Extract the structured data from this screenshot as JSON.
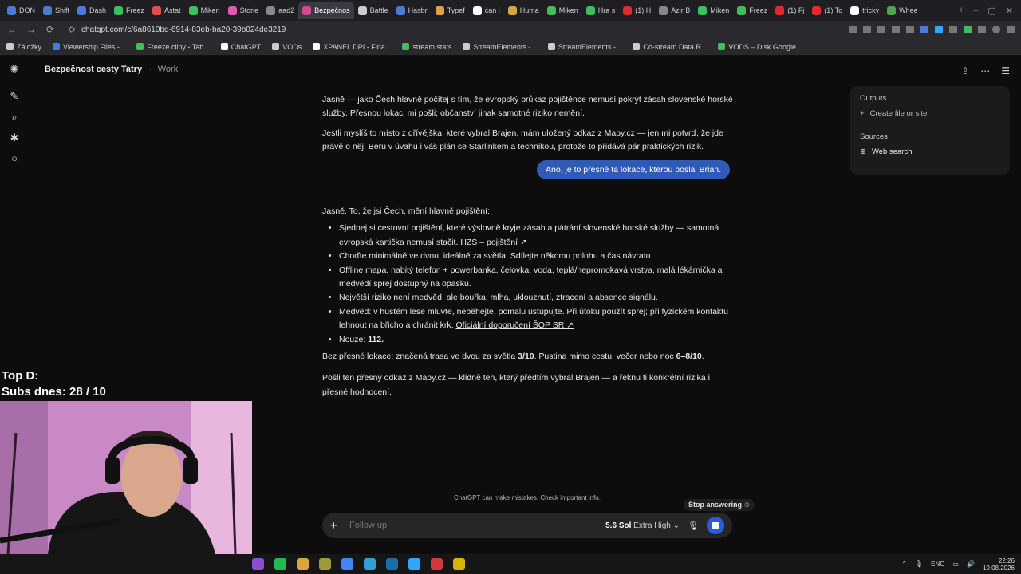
{
  "browser": {
    "tabs": [
      {
        "label": "DON",
        "color": "#4a7bd6"
      },
      {
        "label": "Shift",
        "color": "#4a7bd6"
      },
      {
        "label": "Dash",
        "color": "#4a7bd6"
      },
      {
        "label": "Freez",
        "color": "#3fbf5a"
      },
      {
        "label": "Astat",
        "color": "#e14c4c"
      },
      {
        "label": "Miken",
        "color": "#3fbf5a"
      },
      {
        "label": "Storie",
        "color": "#e05bb0"
      },
      {
        "label": "aad2",
        "color": "#888888"
      },
      {
        "label": "Bezpečnos",
        "color": "#d14a8f",
        "active": true
      },
      {
        "label": "Battle",
        "color": "#cccccc"
      },
      {
        "label": "Hasbr",
        "color": "#4a7bd6"
      },
      {
        "label": "Typef",
        "color": "#d9a441"
      },
      {
        "label": "can i",
        "color": "#ffffff"
      },
      {
        "label": "Huma",
        "color": "#d9a441"
      },
      {
        "label": "Miken",
        "color": "#3fbf5a"
      },
      {
        "label": "Hra s",
        "color": "#3fbf5a"
      },
      {
        "label": "(1) H",
        "color": "#e02b2b"
      },
      {
        "label": "Azir B",
        "color": "#888888"
      },
      {
        "label": "Miken",
        "color": "#3fbf5a"
      },
      {
        "label": "Freez",
        "color": "#3fbf5a"
      },
      {
        "label": "(1) Fj",
        "color": "#e02b2b"
      },
      {
        "label": "(1) To",
        "color": "#e02b2b"
      },
      {
        "label": "tricky",
        "color": "#ffffff"
      },
      {
        "label": "Whee",
        "color": "#4aa84a"
      }
    ],
    "url": "chatgpt.com/c/6a8610bd-6914-83eb-ba20-39b024de3219",
    "bookmarks": [
      {
        "label": "Záložky",
        "color": "#cccccc"
      },
      {
        "label": "Viewership Files -...",
        "color": "#4a7bd6"
      },
      {
        "label": "Freeze clipy - Tab...",
        "color": "#3fbf5a"
      },
      {
        "label": "ChatGPT",
        "color": "#ffffff"
      },
      {
        "label": "VODs",
        "color": "#cccccc"
      },
      {
        "label": "XPANEL DPI - Fina...",
        "color": "#ffffff"
      },
      {
        "label": "stream stats",
        "color": "#3fbf5a"
      },
      {
        "label": "StreamElements -...",
        "color": "#cccccc"
      },
      {
        "label": "StreamElements -...",
        "color": "#cccccc"
      },
      {
        "label": "Co-stream Data R...",
        "color": "#cccccc"
      },
      {
        "label": "VODS – Disk Google",
        "color": "#3fbf5a"
      }
    ]
  },
  "chat": {
    "title": "Bezpečnost cesty Tatry",
    "project": "Work",
    "earlier": [
      "Jasně — jako Čech hlavně počítej s tím, že evropský průkaz pojištěnce nemusí pokrýt zásah slovenské horské služby. Přesnou lokaci mi pošli; občanství jinak samotné riziko nemění.",
      "Jestli myslíš to místo z dřívějška, které vybral Brajen, mám uložený odkaz z Mapy.cz — jen mi potvrď, že jde právě o něj. Beru v úvahu i váš plán se Starlinkem a technikou, protože to přidává pár praktických rizik."
    ],
    "user_message": "Ano, je to přesně ta lokace, kterou poslal Brian.",
    "answer": {
      "intro": "Jasně. To, že jsi Čech, mění hlavně pojištění:",
      "bullets": [
        {
          "text": "Sjednej si cestovní pojištění, které výslovně kryje zásah a pátrání slovenské horské služby — samotná evropská kartička nemusí stačit. ",
          "link": "HZS – pojištění ↗"
        },
        {
          "text": "Choďte minimálně ve dvou, ideálně za světla. Sdílejte někomu polohu a čas návratu."
        },
        {
          "text": "Offline mapa, nabitý telefon + powerbanka, čelovka, voda, teplá/nepromokavá vrstva, malá lékárnička a medvědí sprej dostupný na opasku."
        },
        {
          "text": "Největší riziko není medvěd, ale bouřka, mlha, uklouznutí, ztracení a absence signálu."
        },
        {
          "text": "Medvěd: v hustém lese mluvte, neběhejte, pomalu ustupujte. Při útoku použít sprej; při fyzickém kontaktu lehnout na břicho a chránit krk. ",
          "link": "Oficiální doporučení ŠOP SR ↗"
        },
        {
          "text": "Nouze: ",
          "bold": "112."
        }
      ],
      "summary_pre": "Bez přesné lokace: značená trasa ve dvou za světla ",
      "summary_bold1": "3/10",
      "summary_mid": ". Pustina mimo cestu, večer nebo noc ",
      "summary_bold2": "6–8/10",
      "summary_post": ".",
      "closing": "Pošli ten přesný odkaz z Mapy.cz — klidně ten, který předtím vybral Brajen — a řeknu ti konkrétní rizika i přesné hodnocení."
    }
  },
  "sidepanel": {
    "outputs_label": "Outputs",
    "create_label": "Create file or site",
    "sources_label": "Sources",
    "web_search_label": "Web search"
  },
  "composer": {
    "disclaimer": "ChatGPT can make mistakes. Check important info.",
    "stop_label": "Stop answering",
    "placeholder": "Follow up",
    "model_name": "5.6 Sol",
    "model_mode": "Extra High"
  },
  "overlay": {
    "line1": "Top D:",
    "line2": "Subs dnes: 28 / 10"
  },
  "taskbar": {
    "lang": "ENG",
    "time": "22:26",
    "date": "19.08.2026",
    "apps": [
      "#8a4fd1",
      "#1db954",
      "#d9a441",
      "#9b9b3a",
      "#4285f4",
      "#2f9fd6",
      "#1b6ea8",
      "#2fa7ff",
      "#d23a3a",
      "#d9b100"
    ]
  }
}
